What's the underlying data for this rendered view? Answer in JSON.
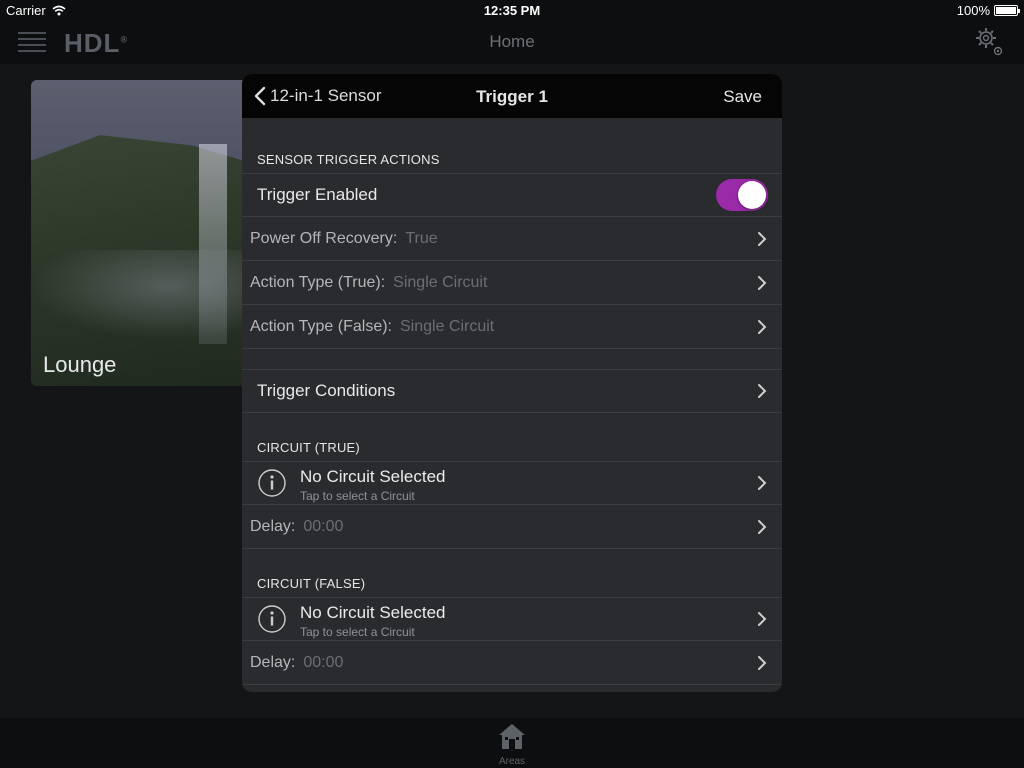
{
  "status_bar": {
    "carrier": "Carrier",
    "time": "12:35 PM",
    "battery": "100%"
  },
  "nav": {
    "logo": "HDL",
    "logo_mark": "®",
    "title": "Home"
  },
  "background": {
    "area_label": "Lounge"
  },
  "tab_bar": {
    "tab_label": "Areas"
  },
  "modal": {
    "back_label": "12-in-1 Sensor",
    "title": "Trigger 1",
    "save_label": "Save",
    "sensor_actions": {
      "header": "SENSOR TRIGGER ACTIONS",
      "trigger_enabled_label": "Trigger Enabled",
      "trigger_enabled": true,
      "power_off_recovery_label": "Power Off Recovery:",
      "power_off_recovery_value": "True",
      "action_true_label": "Action Type (True):",
      "action_true_value": "Single Circuit",
      "action_false_label": "Action Type (False):",
      "action_false_value": "Single Circuit"
    },
    "trigger_conditions_label": "Trigger Conditions",
    "circuit_true": {
      "header": "CIRCUIT (TRUE)",
      "circuit_label": "No Circuit Selected",
      "circuit_hint": "Tap to select a Circuit",
      "delay_label": "Delay:",
      "delay_value": "00:00"
    },
    "circuit_false": {
      "header": "CIRCUIT (FALSE)",
      "circuit_label": "No Circuit Selected",
      "circuit_hint": "Tap to select a Circuit",
      "delay_label": "Delay:",
      "delay_value": "00:00"
    }
  },
  "colors": {
    "toggle_on": "#9a2aa8",
    "modal_bg": "#2a2b2e",
    "header_bg": "#050505",
    "app_bg": "#141517"
  },
  "icons": [
    "wifi-icon",
    "battery-icon",
    "menu-icon",
    "gear-icon",
    "back-chevron-icon",
    "chevron-right-icon",
    "info-icon",
    "home-icon"
  ]
}
